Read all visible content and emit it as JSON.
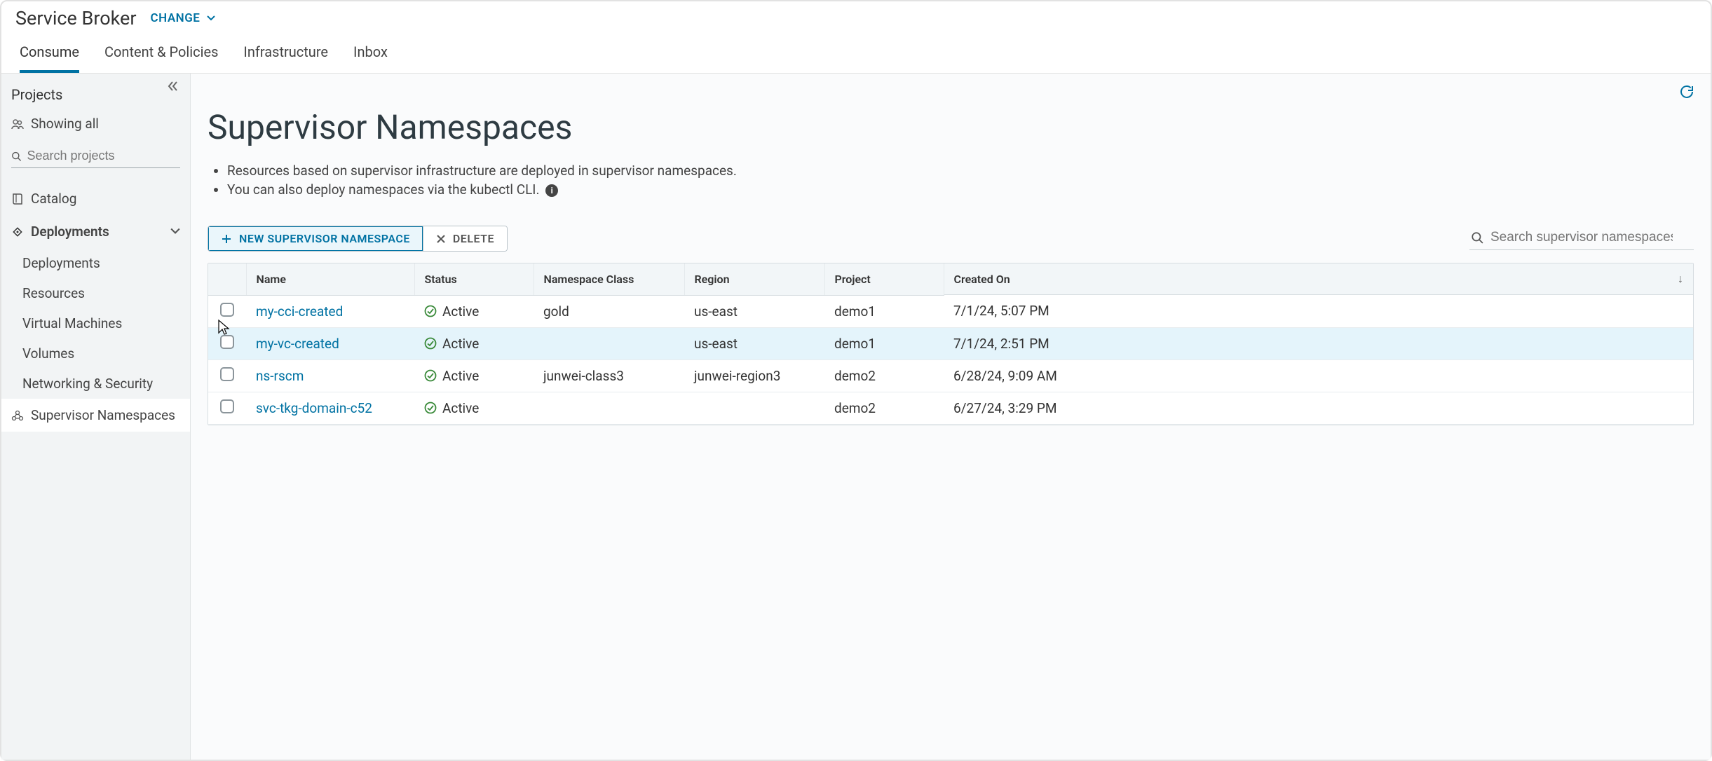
{
  "header": {
    "app_title": "Service Broker",
    "change_label": "CHANGE",
    "tabs": [
      "Consume",
      "Content & Policies",
      "Infrastructure",
      "Inbox"
    ],
    "active_tab_index": 0
  },
  "sidebar": {
    "projects_label": "Projects",
    "showing_all_label": "Showing all",
    "search_placeholder": "Search projects",
    "catalog_label": "Catalog",
    "deployments_label": "Deployments",
    "deployments_children": [
      "Deployments",
      "Resources",
      "Virtual Machines",
      "Volumes",
      "Networking & Security"
    ],
    "supervisor_ns_label": "Supervisor Namespaces"
  },
  "main": {
    "title": "Supervisor Namespaces",
    "desc_lines": [
      "Resources based on supervisor infrastructure are deployed in supervisor namespaces.",
      "You can also deploy namespaces via the kubectl CLI."
    ],
    "new_btn": "NEW SUPERVISOR NAMESPACE",
    "delete_btn": "DELETE",
    "search_placeholder": "Search supervisor namespaces",
    "columns": [
      "Name",
      "Status",
      "Namespace Class",
      "Region",
      "Project",
      "Created On"
    ],
    "rows": [
      {
        "name": "my-cci-created",
        "status": "Active",
        "ns_class": "gold",
        "region": "us-east",
        "project": "demo1",
        "created": "7/1/24, 5:07 PM",
        "highlight": false
      },
      {
        "name": "my-vc-created",
        "status": "Active",
        "ns_class": "",
        "region": "us-east",
        "project": "demo1",
        "created": "7/1/24, 2:51 PM",
        "highlight": true
      },
      {
        "name": "ns-rscm",
        "status": "Active",
        "ns_class": "junwei-class3",
        "region": "junwei-region3",
        "project": "demo2",
        "created": "6/28/24, 9:09 AM",
        "highlight": false
      },
      {
        "name": "svc-tkg-domain-c52",
        "status": "Active",
        "ns_class": "",
        "region": "",
        "project": "demo2",
        "created": "6/27/24, 3:29 PM",
        "highlight": false
      }
    ]
  }
}
